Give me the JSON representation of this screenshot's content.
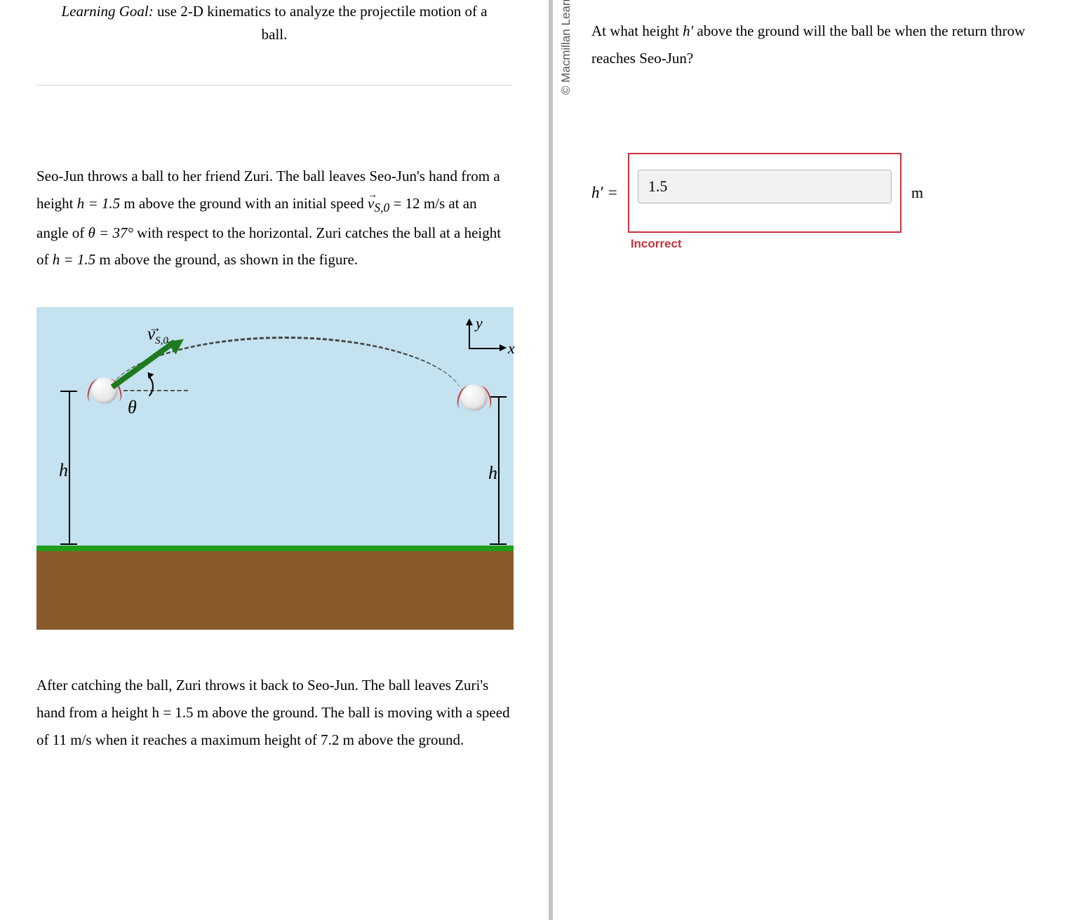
{
  "learning_goal_label": "Learning Goal:",
  "learning_goal_text": " use 2-D kinematics to analyze the projectile motion of a ball.",
  "paragraph1_parts": {
    "p1a": "Seo-Jun throws a ball to her friend Zuri. The ball leaves Seo-Jun's hand from a height ",
    "h_eq": "h = 1.5",
    "p1b": " m above the ground with an initial speed ",
    "v_eq": "v",
    "v_sub": "S,0",
    "v_val": " = 12",
    "p1c": " m/s at an angle of ",
    "theta_eq": "θ = 37°",
    "p1d": " with respect to the horizontal. Zuri catches the ball at a height of ",
    "h2_eq": "h = 1.5",
    "p1e": " m above the ground, as shown in the figure."
  },
  "figure_labels": {
    "h": "h",
    "theta": "θ",
    "v": "v",
    "v_sub": "S,0",
    "y": "y",
    "x": "x"
  },
  "paragraph2": "After catching the ball, Zuri throws it back to Seo-Jun. The ball leaves Zuri's hand from a height h = 1.5 m above the ground. The ball is moving with a speed of 11 m/s when it reaches a maximum height of 7.2 m above the ground.",
  "question_text_a": "At what height ",
  "question_var": "h′",
  "question_text_b": " above the ground will the ball be when the return throw reaches Seo-Jun?",
  "answer": {
    "var_label": "h′ =",
    "value": "1.5",
    "unit": "m",
    "feedback": "Incorrect"
  },
  "copyright": "© Macmillan Learning"
}
